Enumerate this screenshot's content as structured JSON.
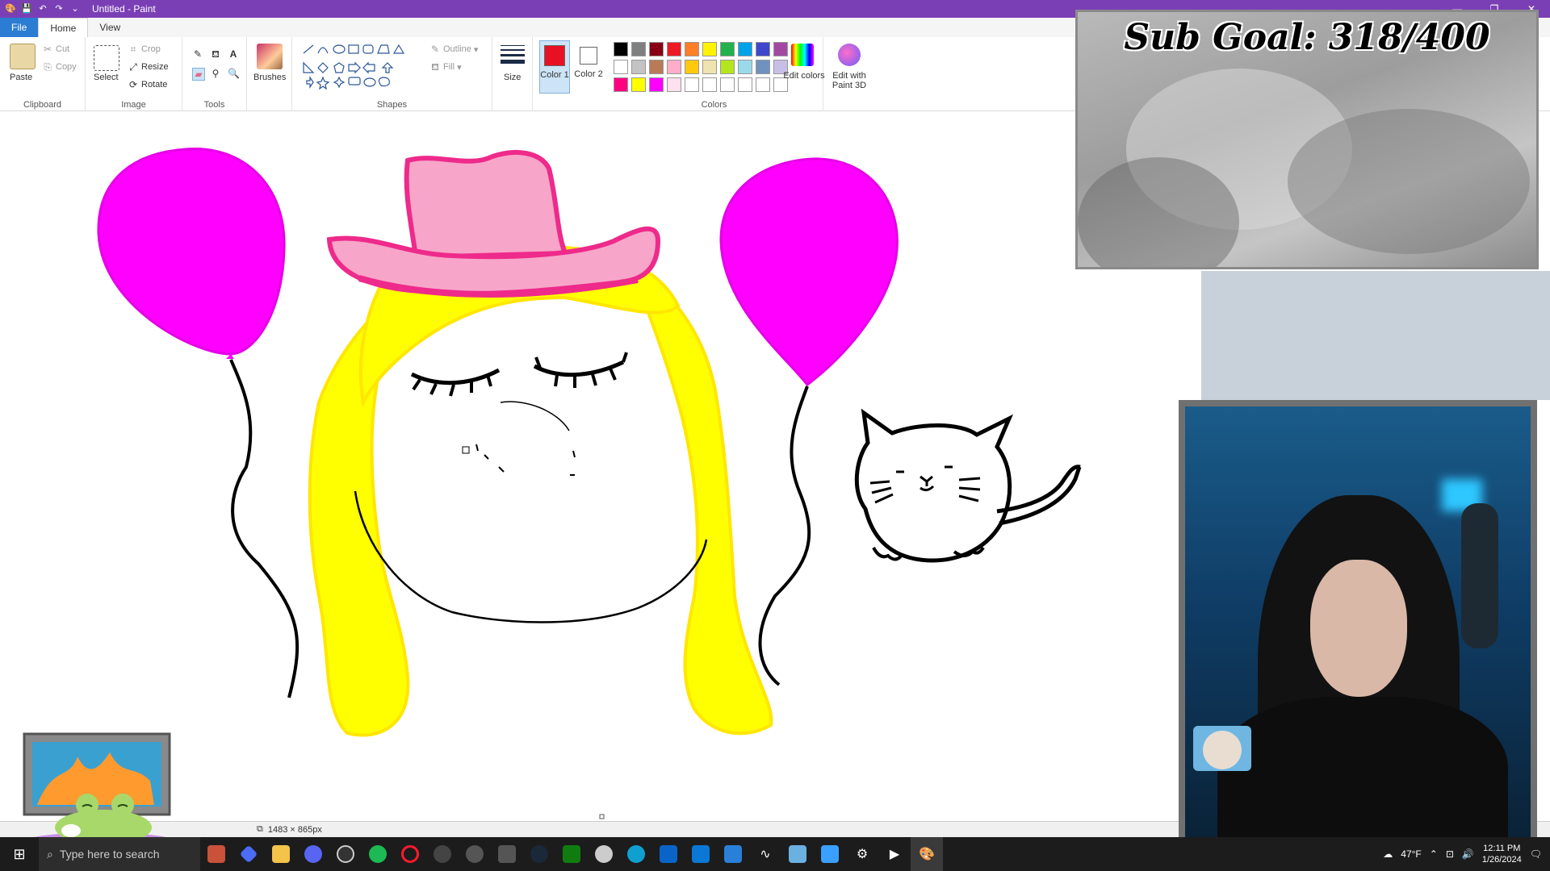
{
  "titlebar": {
    "title": "Untitled - Paint"
  },
  "tabs": {
    "file": "File",
    "home": "Home",
    "view": "View"
  },
  "ribbon": {
    "clipboard": {
      "label": "Clipboard",
      "paste": "Paste",
      "cut": "Cut",
      "copy": "Copy"
    },
    "image": {
      "label": "Image",
      "select": "Select",
      "crop": "Crop",
      "resize": "Resize",
      "rotate": "Rotate"
    },
    "tools": {
      "label": "Tools"
    },
    "brushes": {
      "label": "Brushes"
    },
    "shapes": {
      "label": "Shapes",
      "outline": "Outline",
      "fill": "Fill"
    },
    "size": {
      "label": "Size"
    },
    "color1": {
      "label": "Color 1",
      "value": "#e81123"
    },
    "color2": {
      "label": "Color 2",
      "value": "#ffffff"
    },
    "colors": {
      "label": "Colors"
    },
    "edit_colors": {
      "label": "Edit colors"
    },
    "paint3d": {
      "label": "Edit with Paint 3D"
    },
    "palette": [
      "#000000",
      "#7f7f7f",
      "#880015",
      "#ed1c24",
      "#ff7f27",
      "#fff200",
      "#22b14c",
      "#00a2e8",
      "#3f48cc",
      "#a349a4",
      "#ffffff",
      "#c3c3c3",
      "#b97a57",
      "#ffaec9",
      "#ffc90e",
      "#efe4b0",
      "#b5e61d",
      "#99d9ea",
      "#7092be",
      "#c8bfe7",
      "#ff0080",
      "#ffff00",
      "#ff00ff",
      "#ffe0ef",
      "#ffffff",
      "#ffffff",
      "#ffffff",
      "#ffffff",
      "#ffffff",
      "#ffffff"
    ]
  },
  "statusbar": {
    "dimensions": "1483 × 865px"
  },
  "overlay": {
    "sub_goal": "Sub Goal: 318/400"
  },
  "taskbar": {
    "search_placeholder": "Type here to search",
    "weather": "47°F",
    "time": "12:11 PM",
    "date": "1/26/2024"
  }
}
